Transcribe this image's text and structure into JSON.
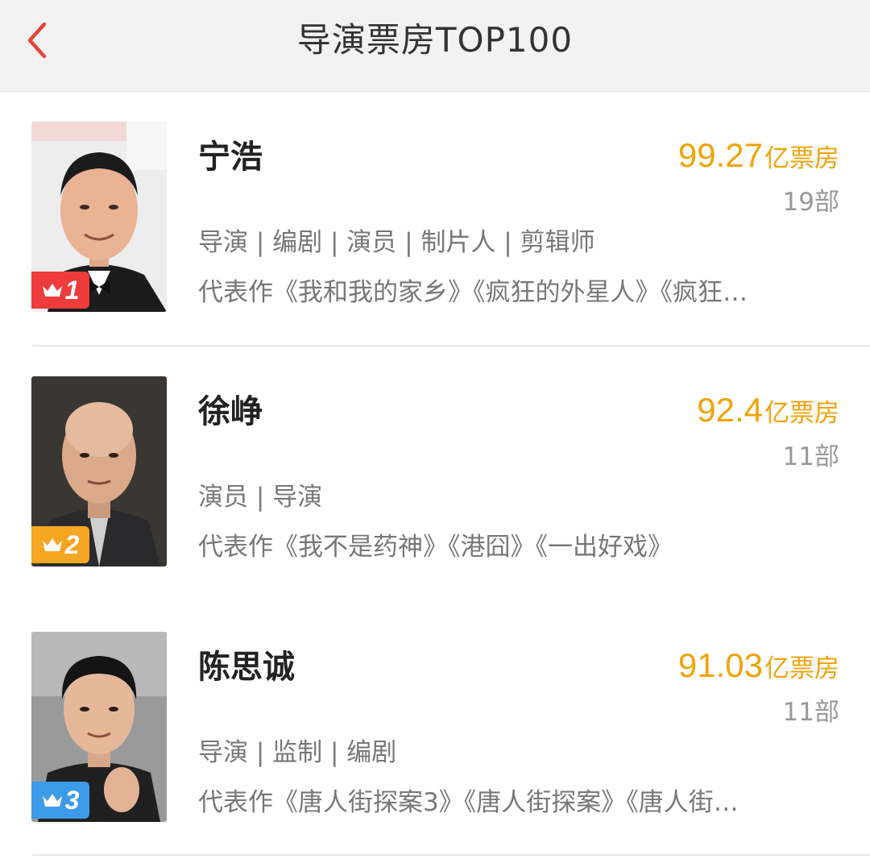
{
  "header": {
    "title": "导演票房TOP100",
    "back_icon": "chevron-left-icon",
    "accent_color": "#e8413a"
  },
  "directors": [
    {
      "rank": "1",
      "name": "宁浩",
      "box_office_value": "99.27",
      "box_office_unit": "亿票房",
      "works_count": "19部",
      "roles": "导演 | 编剧 | 演员 | 制片人 | 剪辑师",
      "works": "代表作《我和我的家乡》《疯狂的外星人》《疯狂…",
      "badge_color": "#ee3c3c"
    },
    {
      "rank": "2",
      "name": "徐峥",
      "box_office_value": "92.4",
      "box_office_unit": "亿票房",
      "works_count": "11部",
      "roles": "演员 | 导演",
      "works": "代表作《我不是药神》《港囧》《一出好戏》",
      "badge_color": "#f5a623"
    },
    {
      "rank": "3",
      "name": "陈思诚",
      "box_office_value": "91.03",
      "box_office_unit": "亿票房",
      "works_count": "11部",
      "roles": "导演 | 监制 | 编剧",
      "works": "代表作《唐人街探案3》《唐人街探案》《唐人街…",
      "badge_color": "#3d9ae8"
    }
  ],
  "colors": {
    "box_office": "#f0a30a",
    "navbar_bg": "#f2f2f2",
    "secondary_text": "#777777"
  }
}
